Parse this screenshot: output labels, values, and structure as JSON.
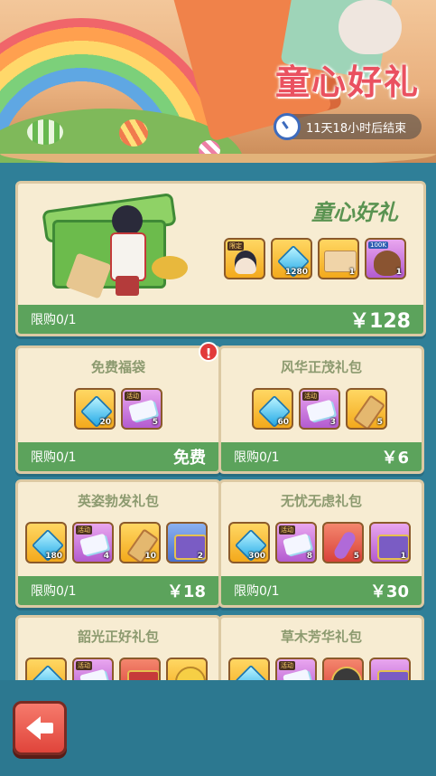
{
  "banner": {
    "title": "童心好礼",
    "timer_text": "11天18小时后结束"
  },
  "featured": {
    "title": "童心好礼",
    "limit": "限购0/1",
    "price": "￥128",
    "items": [
      {
        "icon": "hero-portrait-icon",
        "tag": "限定",
        "qty": ""
      },
      {
        "icon": "diamond-icon",
        "tag": "",
        "qty": "1280"
      },
      {
        "icon": "treasure-map-icon",
        "tag": "",
        "qty": "1"
      },
      {
        "icon": "gold-bag-icon",
        "tag": "100K",
        "qty": "1"
      }
    ]
  },
  "packs": [
    {
      "title": "免费福袋",
      "limit": "限购0/1",
      "price": "免费",
      "qty": [
        "20",
        "5"
      ],
      "tag": "活动"
    },
    {
      "title": "风华正茂礼包",
      "limit": "限购0/1",
      "price": "￥6",
      "qty": [
        "60",
        "3",
        "5"
      ],
      "tag": "活动"
    },
    {
      "title": "英姿勃发礼包",
      "limit": "限购0/1",
      "price": "￥18",
      "qty": [
        "180",
        "4",
        "10",
        "2"
      ],
      "tag": "活动"
    },
    {
      "title": "无忧无虑礼包",
      "limit": "限购0/1",
      "price": "￥30",
      "qty": [
        "300",
        "8",
        "5",
        "1"
      ],
      "tag": "活动"
    },
    {
      "title": "韶光正好礼包",
      "tag": "活动"
    },
    {
      "title": "草木芳华礼包",
      "tag": "活动"
    }
  ],
  "alert_badge": "!",
  "colors": {
    "background": "#2f7f98",
    "panel": "#f7ecd2",
    "footer_green": "#5ca35c",
    "title_pink": "#ea5160"
  }
}
